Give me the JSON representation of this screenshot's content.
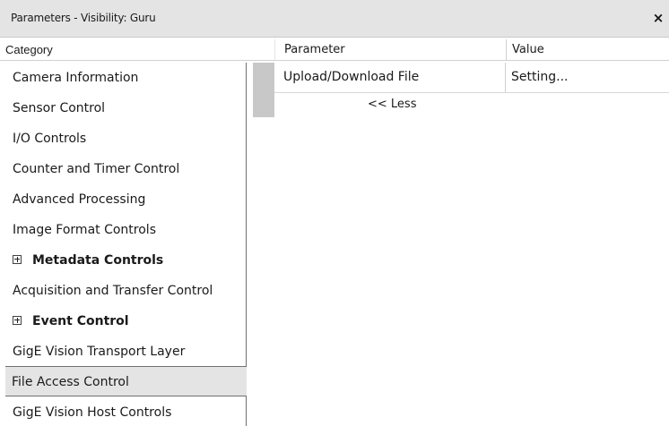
{
  "window": {
    "title": "Parameters - Visibility: Guru",
    "close_label": "×"
  },
  "header": {
    "category": "Category",
    "parameter": "Parameter",
    "value": "Value"
  },
  "categories": [
    {
      "label": "Camera Information",
      "expandable": false,
      "selected": false
    },
    {
      "label": "Sensor Control",
      "expandable": false,
      "selected": false
    },
    {
      "label": "I/O Controls",
      "expandable": false,
      "selected": false
    },
    {
      "label": "Counter and Timer Control",
      "expandable": false,
      "selected": false
    },
    {
      "label": "Advanced Processing",
      "expandable": false,
      "selected": false
    },
    {
      "label": "Image Format Controls",
      "expandable": false,
      "selected": false
    },
    {
      "label": "Metadata Controls",
      "expandable": true,
      "selected": false
    },
    {
      "label": "Acquisition and Transfer Control",
      "expandable": false,
      "selected": false
    },
    {
      "label": "Event Control",
      "expandable": true,
      "selected": false
    },
    {
      "label": "GigE Vision Transport Layer",
      "expandable": false,
      "selected": false
    },
    {
      "label": "File Access Control",
      "expandable": false,
      "selected": true
    },
    {
      "label": "GigE Vision Host Controls",
      "expandable": false,
      "selected": false
    }
  ],
  "parameters": [
    {
      "name": "Upload/Download File",
      "value": "Setting..."
    }
  ],
  "less_label": "<< Less",
  "colors": {
    "titlebar_bg": "#e4e4e4",
    "selected_bg": "#e4e4e4",
    "row_selector": "#c8c8c8"
  }
}
